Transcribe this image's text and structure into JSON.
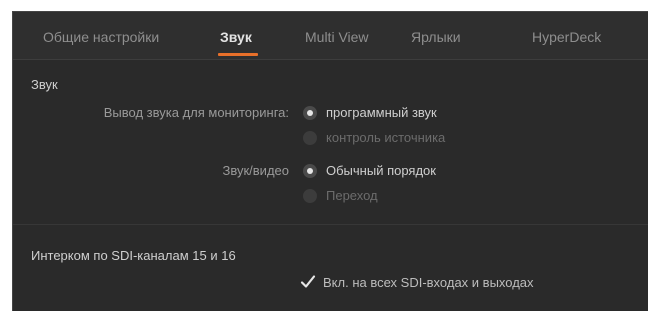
{
  "tabs": [
    {
      "label": "Общие настройки",
      "active": false
    },
    {
      "label": "Звук",
      "active": true
    },
    {
      "label": "Multi View",
      "active": false
    },
    {
      "label": "Ярлыки",
      "active": false
    },
    {
      "label": "HyperDeck",
      "active": false
    }
  ],
  "accent_color": "#e8702a",
  "audio": {
    "section_title": "Звук",
    "monitor_output": {
      "label": "Вывод звука для мониторинга:",
      "options": [
        {
          "label": "программный звук",
          "selected": true
        },
        {
          "label": "контроль источника",
          "selected": false
        }
      ]
    },
    "audio_video": {
      "label": "Звук/видео",
      "options": [
        {
          "label": "Обычный порядок",
          "selected": true
        },
        {
          "label": "Переход",
          "selected": false
        }
      ]
    }
  },
  "intercom": {
    "section_title": "Интерком по SDI-каналам 15 и 16",
    "checkbox": {
      "label": "Вкл. на всех SDI-входах и выходах",
      "checked": true,
      "icon": "checkmark-icon"
    }
  }
}
